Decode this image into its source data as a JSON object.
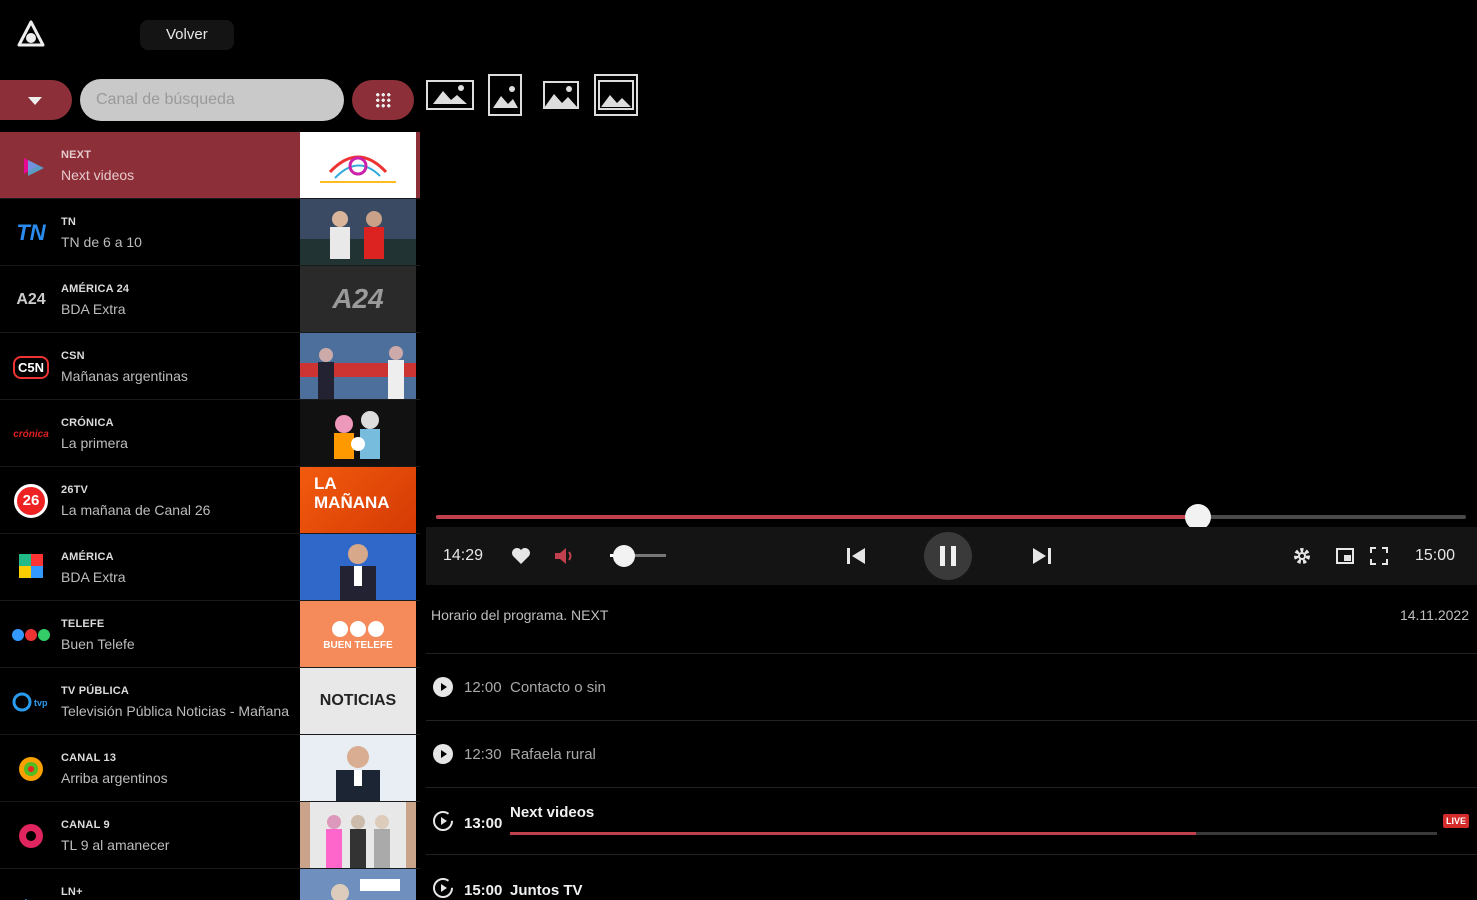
{
  "header": {
    "back_label": "Volver"
  },
  "search": {
    "placeholder": "Canal de búsqueda"
  },
  "channels": [
    {
      "name": "NEXT",
      "show": "Next videos",
      "active": true,
      "logo_text": ""
    },
    {
      "name": "TN",
      "show": "TN de 6 a 10",
      "logo_text": "TN"
    },
    {
      "name": "AMÉRICA 24",
      "show": "BDA Extra",
      "logo_text": "A24"
    },
    {
      "name": "CSN",
      "show": "Mañanas argentinas",
      "logo_text": "C5N"
    },
    {
      "name": "CRÓNICA",
      "show": "La primera",
      "logo_text": "crónica"
    },
    {
      "name": "26TV",
      "show": "La mañana de Canal 26",
      "logo_text": "26"
    },
    {
      "name": "AMÉRICA",
      "show": "BDA Extra",
      "logo_text": ""
    },
    {
      "name": "TELEFE",
      "show": "Buen Telefe",
      "logo_text": ""
    },
    {
      "name": "TV PÚBLICA",
      "show": "Televisión Pública Noticias - Mañana",
      "logo_text": ""
    },
    {
      "name": "CANAL 13",
      "show": "Arriba argentinos",
      "logo_text": ""
    },
    {
      "name": "CANAL 9",
      "show": "TL 9 al amanecer",
      "logo_text": ""
    },
    {
      "name": "LN+",
      "show": "",
      "logo_text": ""
    }
  ],
  "thumbnails": {
    "a24": "A24",
    "la_manana": "LA MAÑANA",
    "buen_telefe": "BUEN TELEFE",
    "noticias": "NOTICIAS"
  },
  "player": {
    "current_time": "14:29",
    "end_time": "15:00",
    "progress": 0.74,
    "volume": 0.25
  },
  "schedule": {
    "title": "Horario del programa. NEXT",
    "date": "14.11.2022",
    "programs": [
      {
        "time": "12:00",
        "title": "Contacto o sin"
      },
      {
        "time": "12:30",
        "title": "Rafaela rural"
      },
      {
        "time": "13:00",
        "title": "Next videos",
        "current": true,
        "progress": 0.74,
        "badge": "LIVE"
      },
      {
        "time": "15:00",
        "title": "Juntos TV"
      }
    ]
  },
  "colors": {
    "accent": "#8c2f39",
    "progress": "#c0404d",
    "live": "#d42b2b"
  }
}
